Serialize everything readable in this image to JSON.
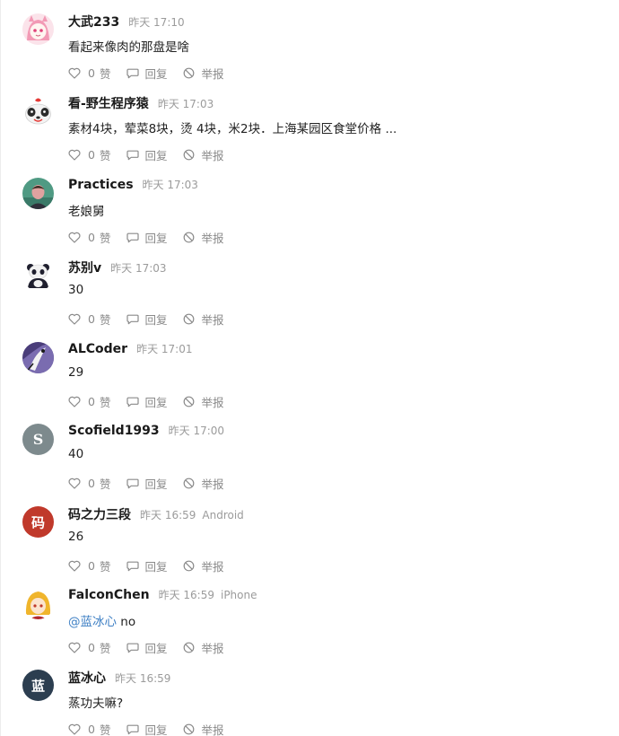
{
  "comments": [
    {
      "username": "大武233",
      "time": "昨天 17:10",
      "device": "",
      "mention": "",
      "content": "看起来像肉的那盘是啥",
      "likes": "0",
      "like_label": "赞",
      "reply_label": "回复",
      "report_label": "举报",
      "avatar_color": "#f6c7d4"
    },
    {
      "username": "看-野生程序猿",
      "time": "昨天 17:03",
      "device": "",
      "mention": "",
      "content": "素材4块，荤菜8块，烫 4块，米2块．上海某园区食堂价格 ...",
      "likes": "0",
      "like_label": "赞",
      "reply_label": "回复",
      "report_label": "举报",
      "avatar_color": "#ffffff"
    },
    {
      "username": "Practices",
      "time": "昨天 17:03",
      "device": "",
      "mention": "",
      "content": "老娘舅",
      "likes": "0",
      "like_label": "赞",
      "reply_label": "回复",
      "report_label": "举报",
      "avatar_color": "#4f9a83"
    },
    {
      "username": "苏别v",
      "time": "昨天 17:03",
      "device": "",
      "mention": "",
      "content": "30",
      "likes": "0",
      "like_label": "赞",
      "reply_label": "回复",
      "report_label": "举报",
      "avatar_color": "#ffffff"
    },
    {
      "username": "ALCoder",
      "time": "昨天 17:01",
      "device": "",
      "mention": "",
      "content": "29",
      "likes": "0",
      "like_label": "赞",
      "reply_label": "回复",
      "report_label": "举报",
      "avatar_color": "#4a3d7a"
    },
    {
      "username": "Scofield1993",
      "time": "昨天 17:00",
      "device": "",
      "mention": "",
      "content": "40",
      "likes": "0",
      "like_label": "赞",
      "reply_label": "回复",
      "report_label": "举报",
      "avatar_color": "#7d8a8d",
      "avatar_letter": "S"
    },
    {
      "username": "码之力三段",
      "time": "昨天 16:59",
      "device": "Android",
      "mention": "",
      "content": "26",
      "likes": "0",
      "like_label": "赞",
      "reply_label": "回复",
      "report_label": "举报",
      "avatar_color": "#c0392b",
      "avatar_letter": "码"
    },
    {
      "username": "FalconChen",
      "time": "昨天 16:59",
      "device": "iPhone",
      "mention": "@蓝冰心",
      "content": " no",
      "likes": "0",
      "like_label": "赞",
      "reply_label": "回复",
      "report_label": "举报",
      "avatar_color": "#ffffff"
    },
    {
      "username": "蓝冰心",
      "time": "昨天 16:59",
      "device": "",
      "mention": "",
      "content": "蒸功夫嘛?",
      "likes": "0",
      "like_label": "赞",
      "reply_label": "回复",
      "report_label": "举报",
      "avatar_color": "#2c3e50",
      "avatar_letter": "蓝"
    }
  ]
}
